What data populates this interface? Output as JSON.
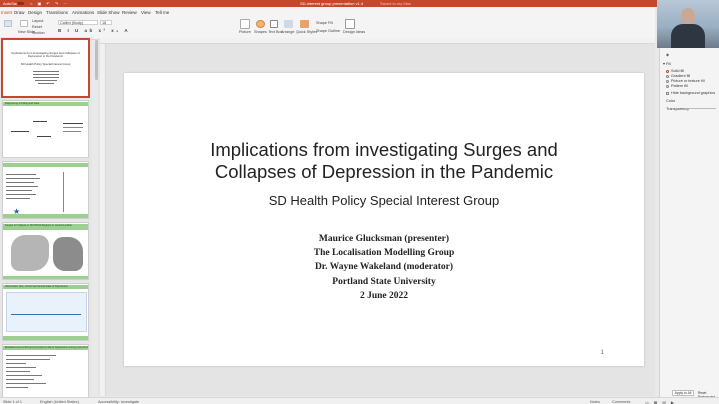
{
  "titlebar": {
    "autosave": "AutoSave",
    "document": "SD-interest group presentation v1.4",
    "saved": "Saved to my Mac"
  },
  "menu": [
    "Insert",
    "Draw",
    "Design",
    "Transitions",
    "Animations",
    "Slide Show",
    "Review",
    "View",
    "Tell me"
  ],
  "menu_active_index": 0,
  "ribbon": {
    "new_slide": "New Slide",
    "layout": "Layout",
    "reset": "Reset",
    "section": "Section",
    "font": "Calibri (Body)",
    "font_size": "18",
    "design_ideas": "Designer",
    "picture": "Picture",
    "shapes": "Shapes",
    "text_box": "Text Box",
    "arrange": "Arrange",
    "quick_styles": "Quick Styles",
    "shape_fill": "Shape Fill",
    "shape_outline": "Shape Outline",
    "design": "Design Ideas"
  },
  "slide": {
    "title_line1": "Implications from investigating Surges and",
    "title_line2": "Collapses of Depression in the Pandemic",
    "subtitle": "SD Health Policy Special Interest Group",
    "authors": [
      "Maurice Glucksman (presenter)",
      "The Localisation Modelling Group",
      "Dr. Wayne Wakeland (moderator)",
      "Portland State University",
      "2 June 2022"
    ],
    "number": "1"
  },
  "thumbnails": {
    "t1_title": "Implications from investigating Surges and Collapses of Depression in the Pandemic",
    "t1_sub": "SD Health Policy Special Interest Group",
    "t2_title": "Diagnosing & Filling and case",
    "t4_title": "Surges & Collapse in 90 MSOA Regions in central London",
    "t5_title": "Vaccination rate, school and actual state of Depression",
    "t6_title": "Modelled and confirmed perceptions about Depression during and post Pandemic"
  },
  "pane": {
    "fill": "Fill",
    "options": [
      "Solid fill",
      "Gradient fill",
      "Picture or texture fill",
      "Pattern fill",
      "Hide background graphics"
    ],
    "selected_option": 0,
    "color": "Color",
    "transparency": "Transparency",
    "apply_all": "Apply to All",
    "reset_bg": "Reset Background"
  },
  "status": {
    "slide_info": "Slide 1 of 1",
    "language": "English (United States)",
    "accessibility": "Accessibility: Investigate",
    "notes": "Notes",
    "comments": "Comments"
  },
  "colors": {
    "accent": "#c8462c",
    "thumb_bar": "#9ccf92"
  }
}
